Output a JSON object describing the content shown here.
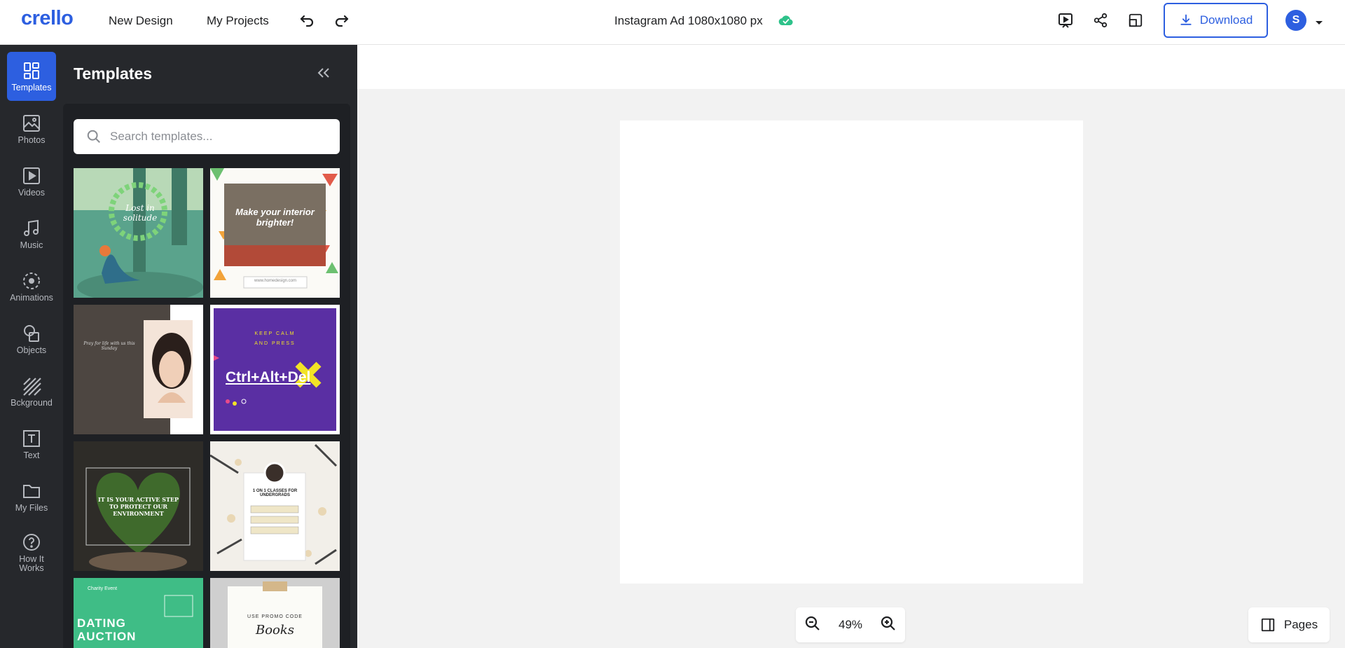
{
  "header": {
    "logo": "crello",
    "nav": [
      "New Design",
      "My Projects"
    ],
    "doc_title": "Instagram Ad 1080x1080 px",
    "download_label": "Download",
    "avatar_initial": "S"
  },
  "rail": [
    {
      "label": "Templates",
      "icon": "templates-icon",
      "active": true
    },
    {
      "label": "Photos",
      "icon": "photos-icon"
    },
    {
      "label": "Videos",
      "icon": "videos-icon"
    },
    {
      "label": "Music",
      "icon": "music-icon"
    },
    {
      "label": "Animations",
      "icon": "animations-icon"
    },
    {
      "label": "Objects",
      "icon": "objects-icon"
    },
    {
      "label": "Bckground",
      "icon": "background-icon"
    },
    {
      "label": "Text",
      "icon": "text-icon"
    },
    {
      "label": "My Files",
      "icon": "folder-icon"
    },
    {
      "label": "How It Works",
      "icon": "help-icon"
    }
  ],
  "panel": {
    "title": "Templates",
    "search_placeholder": "Search templates...",
    "templates": [
      {
        "text": "Lost in solitude"
      },
      {
        "text": "Make your interior brighter!",
        "sub": "www.homedesign.com"
      },
      {
        "text": "Pray for life with us this Sunday"
      },
      {
        "text": "Ctrl+Alt+Del",
        "sub": "KEEP CALM AND PRESS"
      },
      {
        "text": "IT IS YOUR ACTIVE STEP TO PROTECT OUR ENVIRONMENT"
      },
      {
        "text": "1 ON 1 CLASSES FOR UNDERGRADS"
      },
      {
        "text": "DATING AUCTION",
        "sub": "Charity Event"
      },
      {
        "text": "Books",
        "sub": "USE PROMO CODE"
      }
    ]
  },
  "zoom": {
    "value": "49%"
  },
  "pages_label": "Pages",
  "colors": {
    "accent": "#2d5fe0",
    "sidebar": "#26282c",
    "saved": "#2ec28a"
  }
}
